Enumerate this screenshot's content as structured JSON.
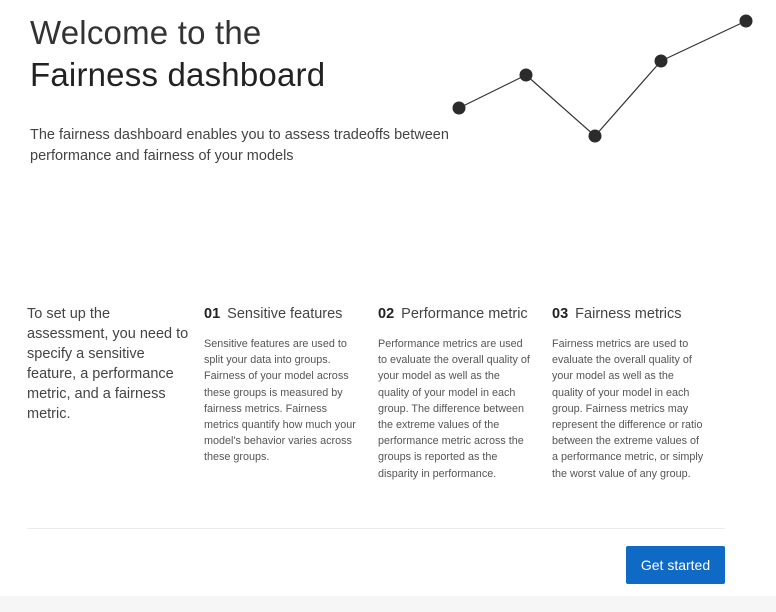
{
  "header": {
    "title_line1": "Welcome to the",
    "title_line2": "Fairness dashboard",
    "subtitle": "The fairness dashboard enables you to assess tradeoffs between performance and fairness of your models"
  },
  "decor_chart": {
    "line_color": "#333333",
    "point_color": "#2b2b2b"
  },
  "setup": {
    "intro": "To set up the assessment, you need to specify a sensitive feature, a performance metric, and a fairness metric.",
    "steps": [
      {
        "number": "01",
        "title": "Sensitive features",
        "body": "Sensitive features are used to split your data into groups. Fairness of your model across these groups is measured by fairness metrics. Fairness metrics quantify how much your model's behavior varies across these groups."
      },
      {
        "number": "02",
        "title": "Performance metric",
        "body": "Performance metrics are used to evaluate the overall quality of your model as well as the quality of your model in each group. The difference between the extreme values of the performance metric across the groups is reported as the disparity in performance."
      },
      {
        "number": "03",
        "title": "Fairness metrics",
        "body": "Fairness metrics are used to evaluate the overall quality of your model as well as the quality of your model in each group. Fairness metrics may represent the difference or ratio between the extreme values of a performance metric, or simply the worst value of any group."
      }
    ]
  },
  "actions": {
    "get_started_label": "Get started",
    "accent_color": "#0e6ac4"
  }
}
